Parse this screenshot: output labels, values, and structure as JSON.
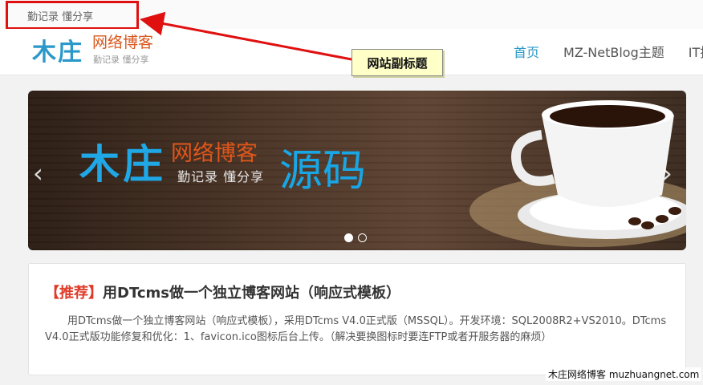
{
  "site": {
    "top_subtitle": "勤记录 懂分享",
    "logo_mark": "木庄",
    "logo_name": "网络博客",
    "logo_subtitle": "勤记录 懂分享"
  },
  "nav": {
    "items": [
      {
        "label": "首页",
        "active": true
      },
      {
        "label": "MZ-NetBlog主题",
        "active": false
      },
      {
        "label": "IT技",
        "active": false
      }
    ]
  },
  "annotation": {
    "callout": "网站副标题",
    "color": "#e01010"
  },
  "banner": {
    "logo_mark": "木庄",
    "logo_name": "网络博客",
    "logo_subtitle": "勤记录 懂分享",
    "headline": "源码",
    "prev_icon": "‹",
    "next_icon": "›",
    "slides": 2,
    "current_slide": 1
  },
  "article": {
    "tag": "【推荐】",
    "title": "用DTcms做一个独立博客网站（响应式模板）",
    "excerpt": "用DTcms做一个独立博客网站（响应式模板），采用DTcms V4.0正式版（MSSQL）。开发环境：SQL2008R2+VS2010。DTcms V4.0正式版功能修复和优化：1、favicon.ico图标后台上传。（解决要换图标时要连FTP或者开服务器的麻烦）"
  },
  "watermark": "木庄网络博客 muzhuangnet.com",
  "colors": {
    "brand_blue": "#2a98c9",
    "brand_orange": "#d9581f",
    "tag_red": "#e03b2a"
  }
}
